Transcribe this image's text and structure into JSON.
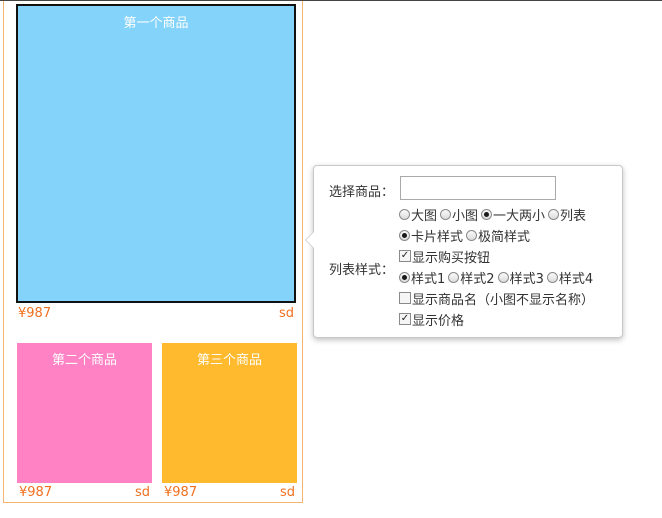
{
  "products": [
    {
      "name": "第一个商品",
      "price": "¥987",
      "tag": "sd",
      "color": "#84d3fa"
    },
    {
      "name": "第二个商品",
      "price": "¥987",
      "tag": "sd",
      "color": "#ff82c4"
    },
    {
      "name": "第三个商品",
      "price": "¥987",
      "tag": "sd",
      "color": "#ffba2e"
    }
  ],
  "settings": {
    "select_label": "选择商品：",
    "select_value": "",
    "size_options": [
      {
        "label": "大图",
        "checked": false
      },
      {
        "label": "小图",
        "checked": false
      },
      {
        "label": "一大两小",
        "checked": true
      },
      {
        "label": "列表",
        "checked": false
      }
    ],
    "card_options": [
      {
        "label": "卡片样式",
        "checked": true
      },
      {
        "label": "极简样式",
        "checked": false
      }
    ],
    "list_style_label": "列表样式：",
    "show_buy_button": {
      "label": "显示购买按钮",
      "checked": true
    },
    "style_options": [
      {
        "label": "样式1",
        "checked": true
      },
      {
        "label": "样式2",
        "checked": false
      },
      {
        "label": "样式3",
        "checked": false
      },
      {
        "label": "样式4",
        "checked": false
      }
    ],
    "show_name": {
      "label": "显示商品名（小图不显示名称）",
      "checked": false
    },
    "show_price": {
      "label": "显示价格",
      "checked": true
    }
  }
}
